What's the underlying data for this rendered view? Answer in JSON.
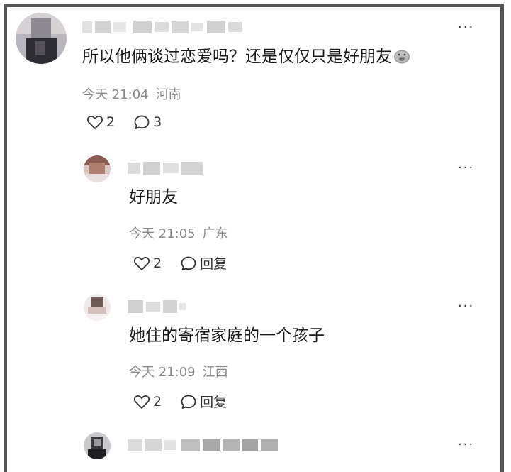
{
  "comments": [
    {
      "text": "所以他俩谈过恋爱吗？还是仅仅只是好朋友",
      "time": "今天 21:04",
      "location": "河南",
      "likes": "2",
      "replies": "3",
      "emoji_icon": "pig-face-emoji-icon"
    },
    {
      "text": "好朋友",
      "time": "今天 21:05",
      "location": "广东",
      "likes": "2",
      "reply_label": "回复"
    },
    {
      "text": "她住的寄宿家庭的一个孩子",
      "time": "今天 21:09",
      "location": "江西",
      "likes": "2",
      "reply_label": "回复"
    }
  ],
  "more_label": "···",
  "colors": {
    "frame": "#555555",
    "meta_gray": "#8a8a8a",
    "text": "#1a1a1a"
  }
}
